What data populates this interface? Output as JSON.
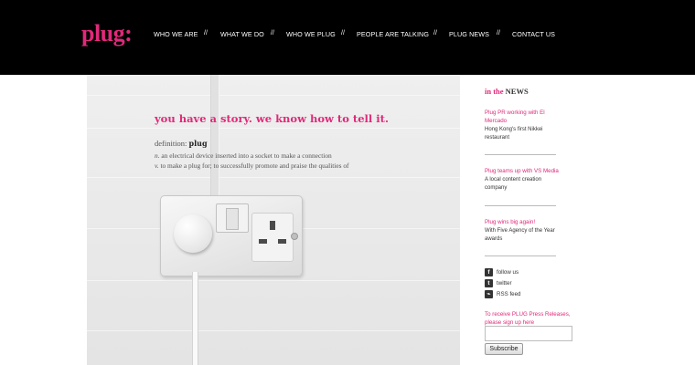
{
  "brand": {
    "logo_text": "plug:",
    "accent_color": "#e0297a"
  },
  "nav": {
    "items": [
      {
        "label": "WHO WE ARE"
      },
      {
        "label": "WHAT WE DO"
      },
      {
        "label": "WHO WE PLUG"
      },
      {
        "label": "PEOPLE ARE TALKING"
      },
      {
        "label": "PLUG NEWS"
      },
      {
        "label": "CONTACT US"
      }
    ],
    "separator": "//"
  },
  "hero": {
    "tagline": "you have a story. we know how to tell it.",
    "definition_label": "definition:",
    "definition_word": "plug",
    "noun_marker": "n.",
    "noun_text": "an electrical device inserted into a socket to make a connection",
    "verb_marker": "v.",
    "verb_text": "to make a plug for; to successfully promote and praise the qualities of"
  },
  "news": {
    "heading_prefix": "in the",
    "heading_word": "NEWS",
    "items": [
      {
        "title": "Plug PR working with El Mercado",
        "desc": "Hong Kong's first Nikkei restaurant"
      },
      {
        "title": "Plug teams up with VS Media",
        "desc": "A local content creation company"
      },
      {
        "title": "Plug wins big again!",
        "desc": "With Five Agency of the Year awards"
      }
    ]
  },
  "social": {
    "items": [
      {
        "label": "follow us",
        "icon": "facebook-icon",
        "glyph": "f"
      },
      {
        "label": "twitter",
        "icon": "twitter-icon",
        "glyph": "t"
      },
      {
        "label": "RSS feed",
        "icon": "rss-icon",
        "glyph": "⌁"
      }
    ]
  },
  "subscribe": {
    "prompt": "To receive PLUG Press Releases, please sign up here",
    "email_placeholder": "",
    "button_label": "Subscribe"
  }
}
